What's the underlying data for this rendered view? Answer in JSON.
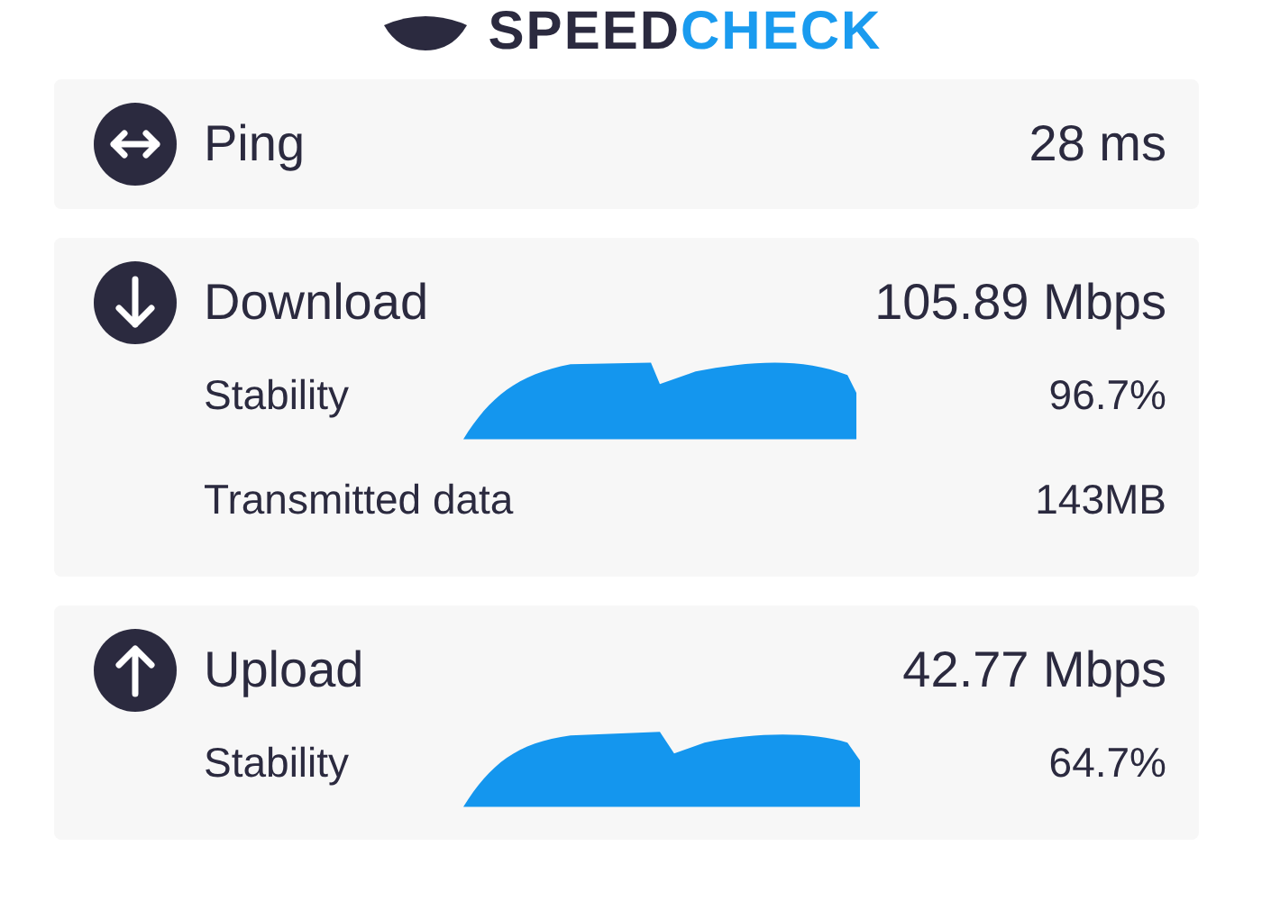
{
  "logo": {
    "dark_part": "SPEED",
    "light_part": "CHECK"
  },
  "results": [
    {
      "kind": "ping",
      "label": "Ping",
      "value": "28 ms"
    },
    {
      "kind": "download",
      "label": "Download",
      "value": "105.89 Mbps",
      "stability_label": "Stability",
      "stability": "96.7%",
      "data_label": "Transmitted data",
      "data": "143MB"
    },
    {
      "kind": "upload",
      "label": "Upload",
      "value": "42.77 Mbps",
      "stability_label": "Stability",
      "stability": "64.7%"
    }
  ]
}
